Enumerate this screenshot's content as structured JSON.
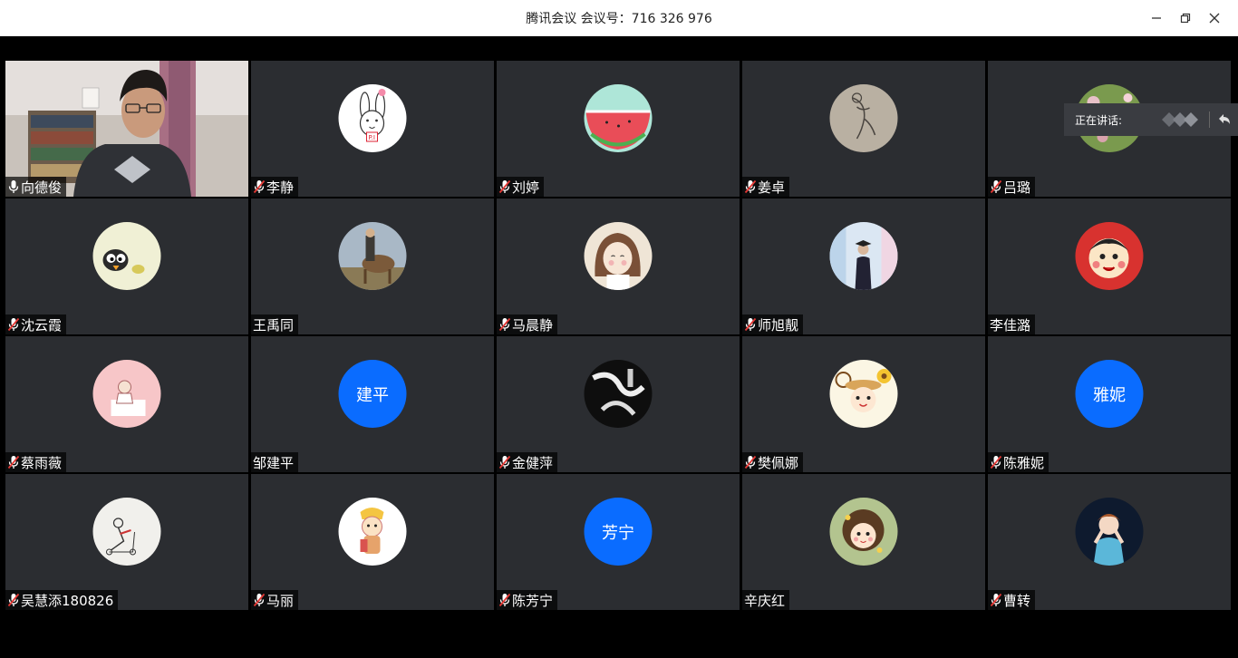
{
  "window": {
    "title": "腾讯会议 会议号：716 326 976"
  },
  "speaking_panel": {
    "label": "正在讲话:"
  },
  "participants": [
    {
      "name": "向德俊",
      "mic": "on",
      "avatar": "video"
    },
    {
      "name": "李静",
      "mic": "muted",
      "avatar": "bunny"
    },
    {
      "name": "刘婷",
      "mic": "muted",
      "avatar": "watermelon"
    },
    {
      "name": "姜卓",
      "mic": "muted",
      "avatar": "sketch"
    },
    {
      "name": "吕璐",
      "mic": "muted",
      "avatar": "flowers"
    },
    {
      "name": "沈云霞",
      "mic": "muted",
      "avatar": "cartoon-bird"
    },
    {
      "name": "王禹同",
      "mic": "none",
      "avatar": "horse-rider"
    },
    {
      "name": "马晨静",
      "mic": "muted",
      "avatar": "girl-illustration"
    },
    {
      "name": "师旭靓",
      "mic": "muted",
      "avatar": "graduate"
    },
    {
      "name": "李佳潞",
      "mic": "none",
      "avatar": "cartoon-boy-red"
    },
    {
      "name": "蔡雨薇",
      "mic": "muted",
      "avatar": "pink-drawing"
    },
    {
      "name": "邹建平",
      "mic": "none",
      "avatar": "text",
      "avatar_text": "建平",
      "color": "#0a6cff"
    },
    {
      "name": "金健萍",
      "mic": "muted",
      "avatar": "dark-abstract"
    },
    {
      "name": "樊佩娜",
      "mic": "muted",
      "avatar": "girl-sunflower"
    },
    {
      "name": "陈雅妮",
      "mic": "muted",
      "avatar": "text",
      "avatar_text": "雅妮",
      "color": "#0a6cff"
    },
    {
      "name": "吴慧添180826",
      "mic": "muted",
      "avatar": "scooter"
    },
    {
      "name": "马丽",
      "mic": "muted",
      "avatar": "cartoon-cat"
    },
    {
      "name": "陈芳宁",
      "mic": "muted",
      "avatar": "text",
      "avatar_text": "芳宁",
      "color": "#0a6cff"
    },
    {
      "name": "辛庆红",
      "mic": "none",
      "avatar": "curly-girl"
    },
    {
      "name": "曹转",
      "mic": "muted",
      "avatar": "blue-princess"
    }
  ]
}
